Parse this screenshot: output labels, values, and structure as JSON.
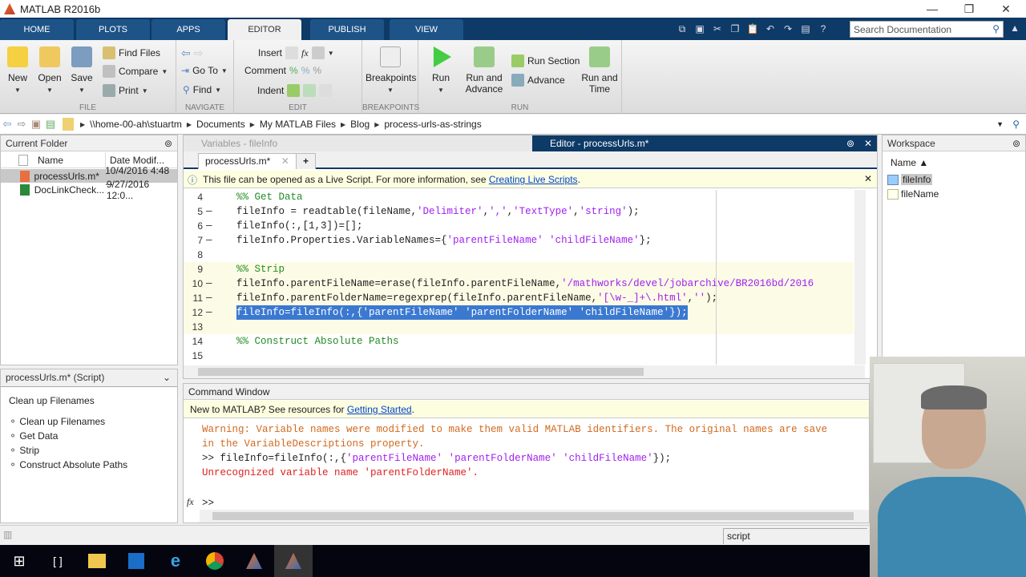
{
  "window": {
    "title": "MATLAB R2016b",
    "controls": {
      "minimize": "—",
      "restore": "❐",
      "close": "✕"
    }
  },
  "ribbon_tabs": [
    {
      "label": "HOME"
    },
    {
      "label": "PLOTS"
    },
    {
      "label": "APPS"
    },
    {
      "label": "EDITOR",
      "active": true
    },
    {
      "label": "PUBLISH"
    },
    {
      "label": "VIEW"
    }
  ],
  "search": {
    "placeholder": "Search Documentation"
  },
  "ribbon": {
    "file": {
      "label": "FILE",
      "new": "New",
      "open": "Open",
      "save": "Save",
      "find_files": "Find Files",
      "compare": "Compare",
      "print": "Print"
    },
    "navigate": {
      "label": "NAVIGATE",
      "goto": "Go To",
      "find": "Find"
    },
    "edit": {
      "label": "EDIT",
      "insert": "Insert",
      "comment": "Comment",
      "indent": "Indent",
      "fx": "fx"
    },
    "breakpoints": {
      "label": "BREAKPOINTS",
      "button": "Breakpoints"
    },
    "run": {
      "label": "RUN",
      "run": "Run",
      "run_advance": "Run and Advance",
      "run_section": "Run Section",
      "advance": "Advance",
      "run_time": "Run and Time"
    }
  },
  "address": {
    "crumbs": [
      "\\\\home-00-ah\\stuartm",
      "Documents",
      "My MATLAB Files",
      "Blog",
      "process-urls-as-strings"
    ]
  },
  "current_folder": {
    "title": "Current Folder",
    "columns": [
      "Name",
      "Date Modif..."
    ],
    "rows": [
      {
        "name": "processUrls.m*",
        "date": "10/4/2016 4:48 ...",
        "selected": true
      },
      {
        "name": "DocLinkCheck...",
        "date": "9/27/2016 12:0..."
      }
    ]
  },
  "details": {
    "header": "processUrls.m* (Script)",
    "title": "Clean up Filenames",
    "sections": [
      "Clean up Filenames",
      "Get Data",
      "Strip",
      "Construct Absolute Paths"
    ]
  },
  "editor": {
    "variables_title": "Variables - fileInfo",
    "title": "Editor - processUrls.m*",
    "tab": "processUrls.m*",
    "add_tab": "+",
    "info": "This file can be opened as a Live Script. For more information, see ",
    "info_link": "Creating Live Scripts",
    "lines": [
      {
        "n": "4",
        "dash": "",
        "parts": [
          {
            "t": "%% Get Data",
            "c": "cm"
          }
        ]
      },
      {
        "n": "5",
        "dash": "—",
        "parts": [
          {
            "t": "fileInfo = readtable(fileName,"
          },
          {
            "t": "'Delimiter'",
            "c": "st"
          },
          {
            "t": ","
          },
          {
            "t": "','",
            "c": "st"
          },
          {
            "t": ","
          },
          {
            "t": "'TextType'",
            "c": "st"
          },
          {
            "t": ","
          },
          {
            "t": "'string'",
            "c": "st"
          },
          {
            "t": ");"
          }
        ]
      },
      {
        "n": "6",
        "dash": "—",
        "parts": [
          {
            "t": "fileInfo(:,[1,3])=[];"
          }
        ]
      },
      {
        "n": "7",
        "dash": "—",
        "parts": [
          {
            "t": "fileInfo.Properties.VariableNames={"
          },
          {
            "t": "'parentFileName'",
            "c": "st"
          },
          {
            "t": " "
          },
          {
            "t": "'childFileName'",
            "c": "st"
          },
          {
            "t": "};"
          }
        ]
      },
      {
        "n": "8",
        "dash": "",
        "parts": []
      },
      {
        "n": "9",
        "dash": "",
        "sect": true,
        "parts": [
          {
            "t": "%% Strip",
            "c": "cm"
          }
        ]
      },
      {
        "n": "10",
        "dash": "—",
        "sect": true,
        "parts": [
          {
            "t": "fileInfo.parentFileName=erase(fileInfo.parentFileName,"
          },
          {
            "t": "'/mathworks/devel/jobarchive/BR2016bd/2016",
            "c": "st"
          }
        ]
      },
      {
        "n": "11",
        "dash": "—",
        "sect": true,
        "parts": [
          {
            "t": "fileInfo.parentFolderName=regexprep(fileInfo.parentFileName,"
          },
          {
            "t": "'[\\w-_]+\\.html'",
            "c": "st"
          },
          {
            "t": ","
          },
          {
            "t": "''",
            "c": "st"
          },
          {
            "t": ");"
          }
        ]
      },
      {
        "n": "12",
        "dash": "—",
        "sect": true,
        "hl": true,
        "parts": [
          {
            "t": "fileInfo=fileInfo(:,{"
          },
          {
            "t": "'parentFileName'",
            "c": "st"
          },
          {
            "t": " "
          },
          {
            "t": "'parentFolderName'",
            "c": "st"
          },
          {
            "t": " "
          },
          {
            "t": "'childFileName'",
            "c": "st"
          },
          {
            "t": "});"
          }
        ]
      },
      {
        "n": "13",
        "dash": "",
        "sect": true,
        "parts": []
      },
      {
        "n": "14",
        "dash": "",
        "parts": [
          {
            "t": "%% Construct Absolute Paths",
            "c": "cm"
          }
        ]
      },
      {
        "n": "15",
        "dash": "",
        "parts": []
      }
    ]
  },
  "command_window": {
    "title": "Command Window",
    "info": "New to MATLAB? See resources for ",
    "info_link": "Getting Started",
    "lines": [
      {
        "t": "Warning: Variable names were modified to make them valid MATLAB identifiers. The original names are save",
        "c": "warn"
      },
      {
        "t": "in the VariableDescriptions property.",
        "c": "warn"
      },
      {
        "t": ">> fileInfo=fileInfo(:,{'parentFileName' 'parentFolderName' 'childFileName'});",
        "c": ""
      },
      {
        "t": "Unrecognized variable name 'parentFolderName'.",
        "c": "err"
      }
    ],
    "prompt": ">>",
    "fx": "fx"
  },
  "workspace": {
    "title": "Workspace",
    "column": "Name ▲",
    "vars": [
      {
        "name": "fileInfo",
        "selected": true
      },
      {
        "name": "fileName"
      }
    ]
  },
  "statusbar": {
    "mode": "script"
  }
}
